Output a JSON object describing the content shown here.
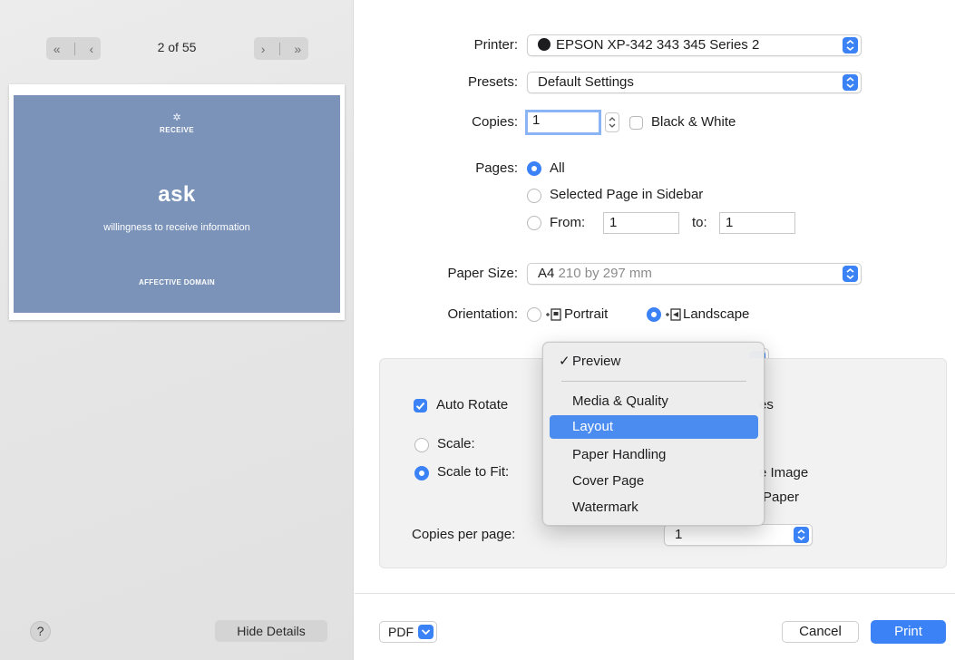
{
  "sidebar": {
    "nav_first_label": "«",
    "nav_prev_label": "‹",
    "nav_next_label": "›",
    "nav_last_label": "»",
    "page_indicator": "2 of 55",
    "thumbnail": {
      "heading": "RECEIVE",
      "title": "ask",
      "subtitle": "willingness to receive information",
      "footer": "AFFECTIVE DOMAIN"
    },
    "help_label": "?",
    "hide_details_label": "Hide Details"
  },
  "form": {
    "printer_label": "Printer:",
    "printer_value": "EPSON XP-342 343 345 Series 2",
    "presets_label": "Presets:",
    "presets_value": "Default Settings",
    "copies_label": "Copies:",
    "copies_value": "1",
    "black_white_label": "Black & White",
    "pages_label": "Pages:",
    "pages_all": "All",
    "pages_selected": "Selected Page in Sidebar",
    "pages_from": "From:",
    "pages_from_value": "1",
    "pages_to": "to:",
    "pages_to_value": "1",
    "paper_size_label": "Paper Size:",
    "paper_size_value": "A4",
    "paper_size_detail": "210 by 297 mm",
    "orientation_label": "Orientation:",
    "orientation_portrait": "Portrait",
    "orientation_landscape": "Landscape"
  },
  "layout_panel": {
    "auto_rotate": "Auto Rotate",
    "auto_rotate_tail": "es",
    "scale": "Scale:",
    "scale_to_fit": "Scale to Fit:",
    "fit_image_tail": "e Image",
    "fit_paper_tail": "Paper",
    "copies_per_page_label": "Copies per page:",
    "copies_per_page_value": "1"
  },
  "menu": {
    "items": [
      "Preview",
      "Media & Quality",
      "Layout",
      "Paper Handling",
      "Cover Page",
      "Watermark"
    ],
    "checked": "Preview",
    "highlighted": "Layout"
  },
  "footer": {
    "pdf_label": "PDF",
    "cancel_label": "Cancel",
    "print_label": "Print"
  },
  "colors": {
    "accent": "#3a82f6",
    "thumbnail_bg": "#7b93b9",
    "menu_highlight": "#4a8cf0"
  }
}
